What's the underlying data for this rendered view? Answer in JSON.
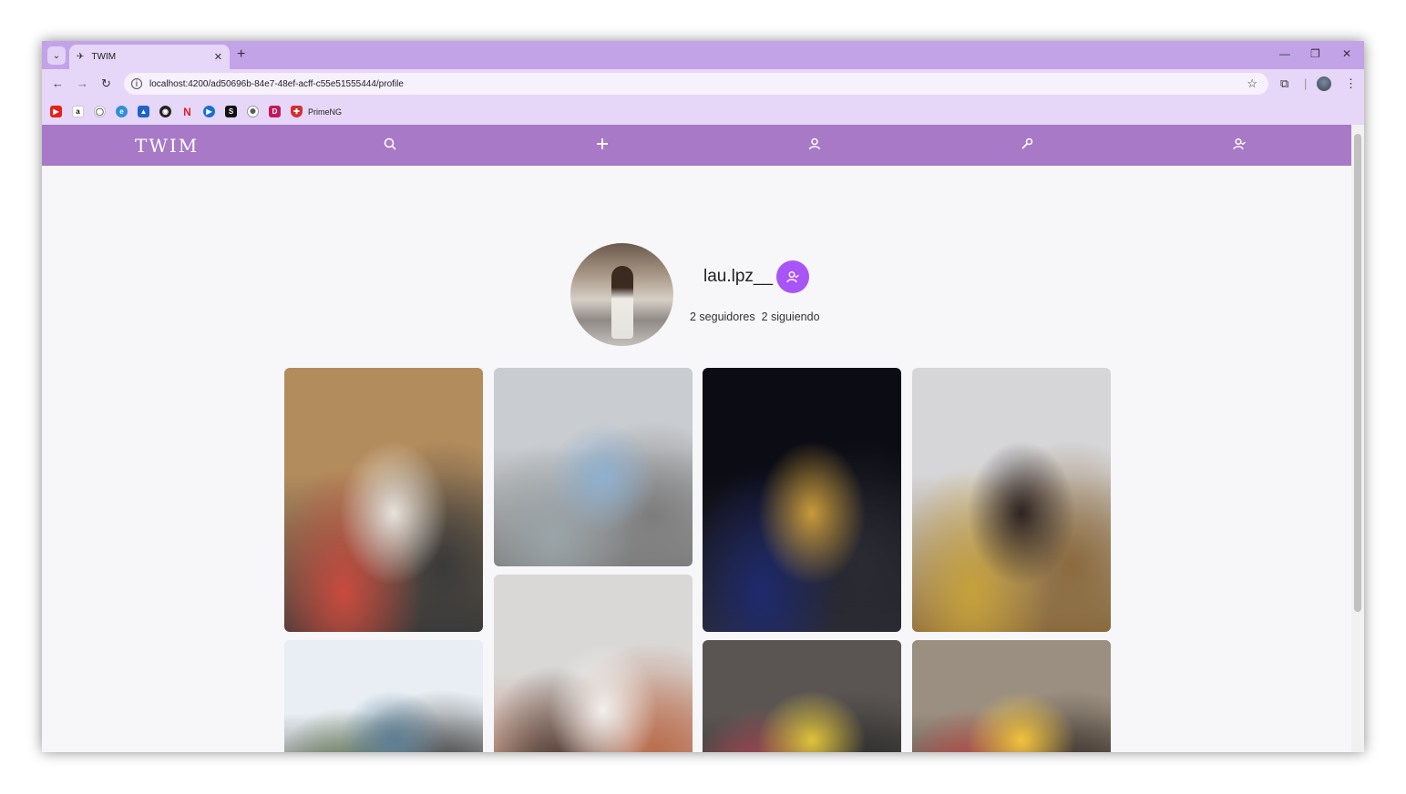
{
  "browser": {
    "tab_title": "TWIM",
    "url": "localhost:4200/ad50696b-84e7-48ef-acff-c55e51555444/profile",
    "bookmarks": [
      {
        "icon": "youtube-icon",
        "color": "#e62117"
      },
      {
        "icon": "amazon-icon",
        "color": "#ffffff"
      },
      {
        "icon": "github-icon",
        "color": "#ffffff"
      },
      {
        "icon": "edge-icon",
        "color": "#2e8fd6"
      },
      {
        "icon": "graduation-cap-icon",
        "color": "#1e64c8"
      },
      {
        "icon": "globe-icon",
        "color": "#222222"
      },
      {
        "icon": "netflix-icon",
        "color": "#d81f26"
      },
      {
        "icon": "play-icon",
        "color": "#1a6fd1"
      },
      {
        "icon": "s-icon",
        "color": "#111111"
      },
      {
        "icon": "chatgpt-icon",
        "color": "#666666"
      },
      {
        "icon": "d-icon",
        "color": "#c2185b"
      },
      {
        "icon": "shield-icon",
        "color": "#d32f2f",
        "label": "PrimeNG"
      }
    ]
  },
  "app": {
    "brand": "TWIM",
    "nav": [
      "search-icon",
      "plus-icon",
      "user-icon",
      "wrench-icon",
      "user-check-icon"
    ]
  },
  "profile": {
    "username": "lau.lpz__",
    "followers": "2 seguidores",
    "following": "2 siguiendo"
  },
  "photos": [
    {
      "name": "photo-airport",
      "colors": [
        "#b38c5d",
        "#c94a3e",
        "#e8e2dc",
        "#3a3a3a"
      ]
    },
    {
      "name": "photo-church",
      "colors": [
        "#c9ccd0",
        "#9aa4a8",
        "#8fb0cf",
        "#7d7d7d"
      ]
    },
    {
      "name": "photo-ferris-wheel-night",
      "colors": [
        "#0c0c14",
        "#1e2a6e",
        "#c89a3b",
        "#2b2b33"
      ]
    },
    {
      "name": "photo-museum-sunflowers",
      "colors": [
        "#d6d6d8",
        "#c7a13a",
        "#2d2320",
        "#8a6a3e"
      ]
    },
    {
      "name": "photo-canal-group",
      "colors": [
        "#e8eef3",
        "#4f6a3a",
        "#5d7f94",
        "#3b3a3a"
      ]
    },
    {
      "name": "photo-costume-friends",
      "colors": [
        "#dad8d6",
        "#3a2c27",
        "#f1efee",
        "#b86b4b"
      ]
    },
    {
      "name": "photo-tulips",
      "colors": [
        "#5a5552",
        "#d64657",
        "#e0c33c",
        "#2b2b2b"
      ]
    },
    {
      "name": "photo-street-friends",
      "colors": [
        "#9a8f80",
        "#d83b3b",
        "#f2c23c",
        "#3a2f2a"
      ]
    }
  ]
}
